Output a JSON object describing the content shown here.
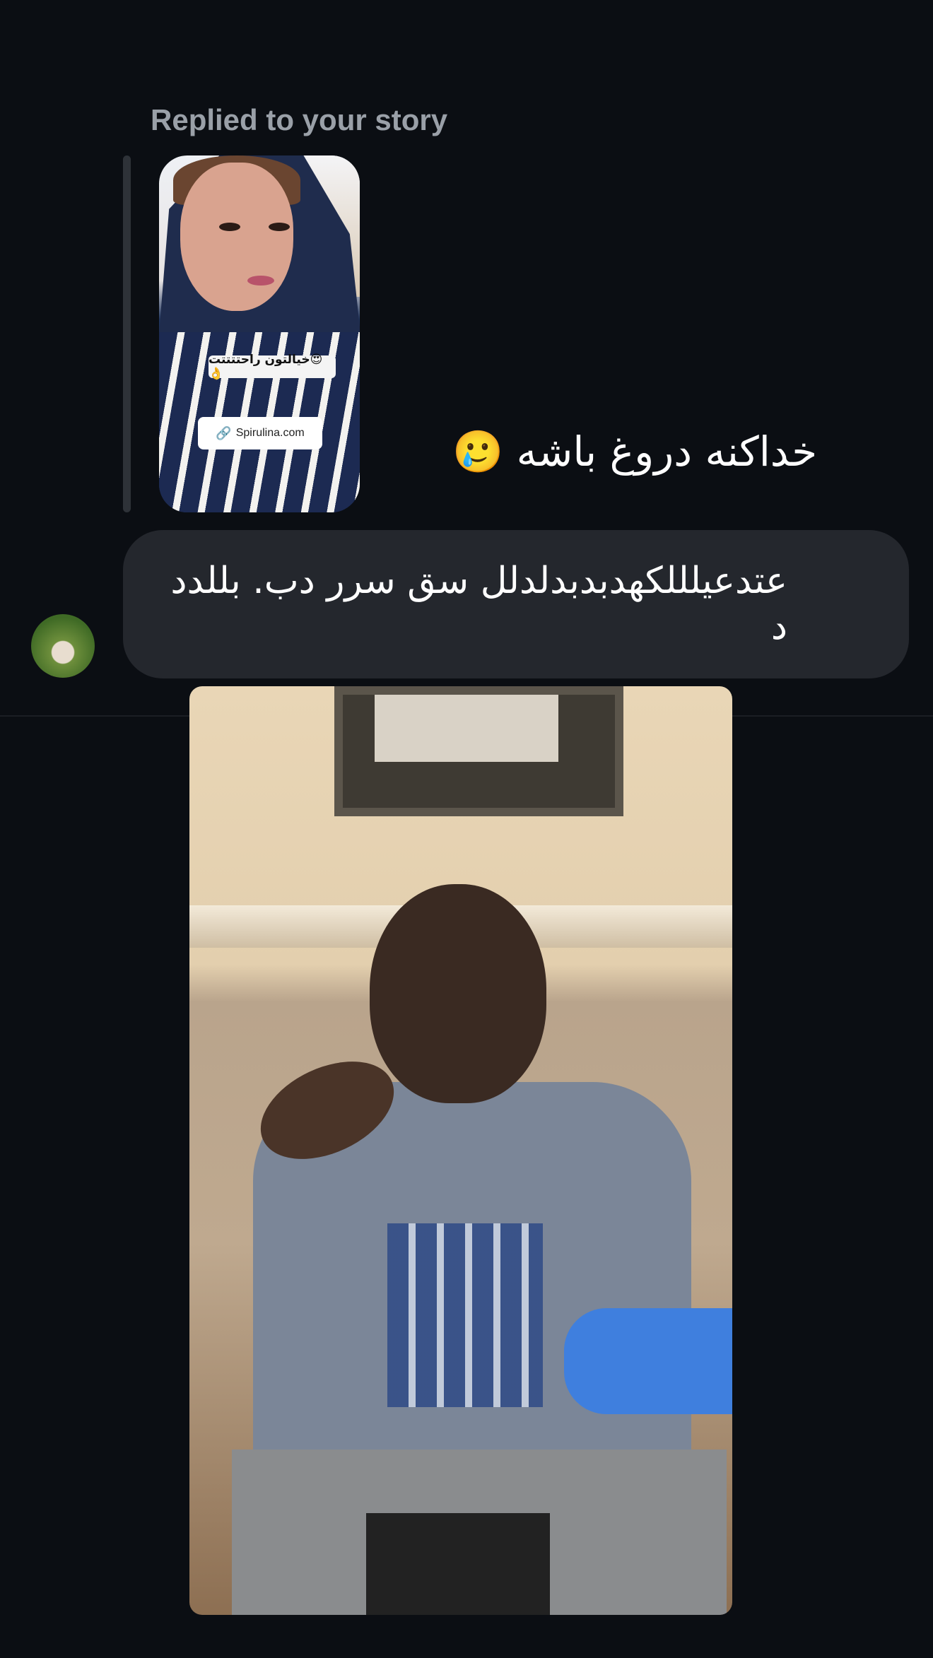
{
  "story_reply": {
    "label": "Replied to your story",
    "story": {
      "sticker_text": "خیالتون راحتتتتت😍👌",
      "link_text": "Spirulina.com"
    },
    "reply_text": "خداکنه دروغ باشه 🥲"
  },
  "message": {
    "text": "عتدعیلللکهدبدبدلدلل سق سرر دب. بللدد د"
  },
  "icons": {
    "link": "link-icon"
  }
}
